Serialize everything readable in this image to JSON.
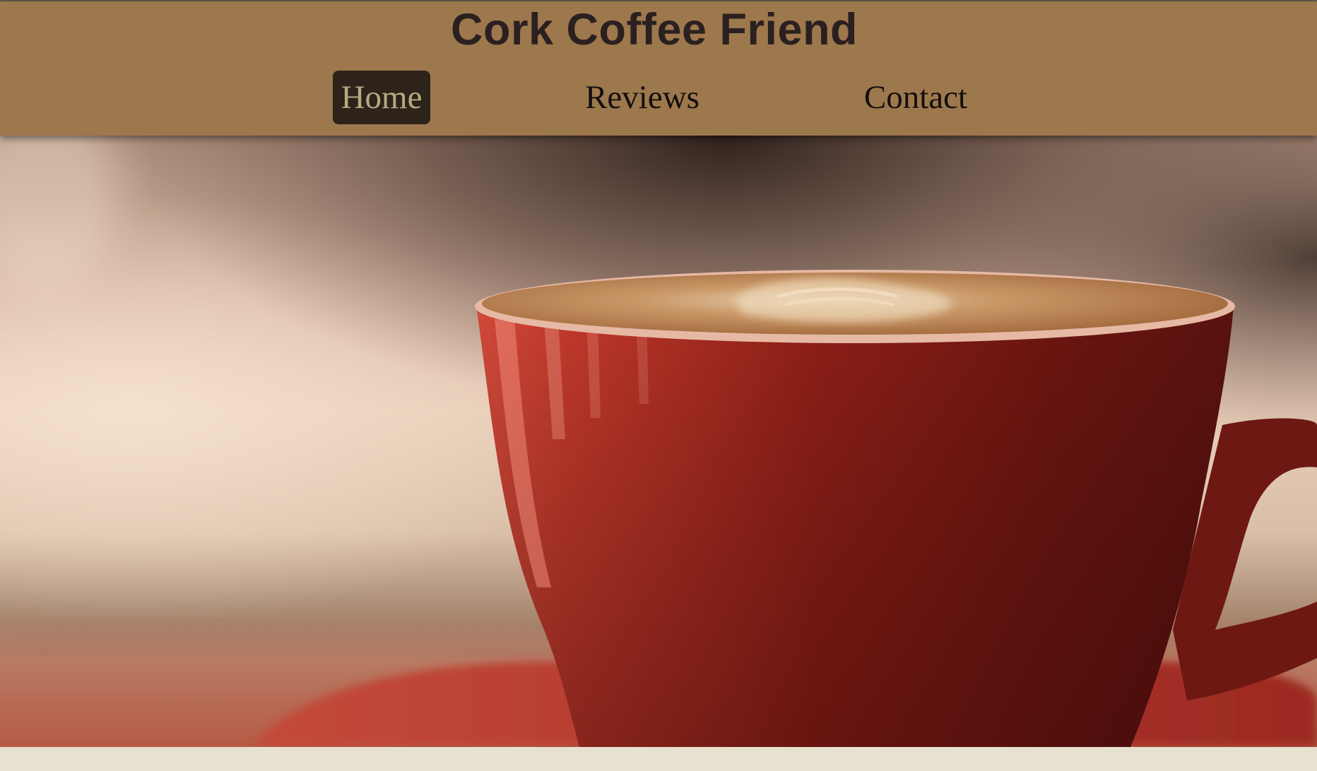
{
  "header": {
    "title": "Cork Coffee Friend"
  },
  "nav": {
    "items": [
      {
        "label": "Home",
        "active": true
      },
      {
        "label": "Reviews",
        "active": false
      },
      {
        "label": "Contact",
        "active": false
      }
    ]
  },
  "hero": {
    "image": "red-coffee-cup-latte"
  },
  "colors": {
    "header_bg": "#9d784d",
    "title_text": "#2b2020",
    "nav_active_bg": "#2e231b",
    "nav_active_text": "#b2ac80",
    "nav_text": "#140f0d",
    "page_bg": "#e7e1d0",
    "cup_red": "#b3271c"
  }
}
